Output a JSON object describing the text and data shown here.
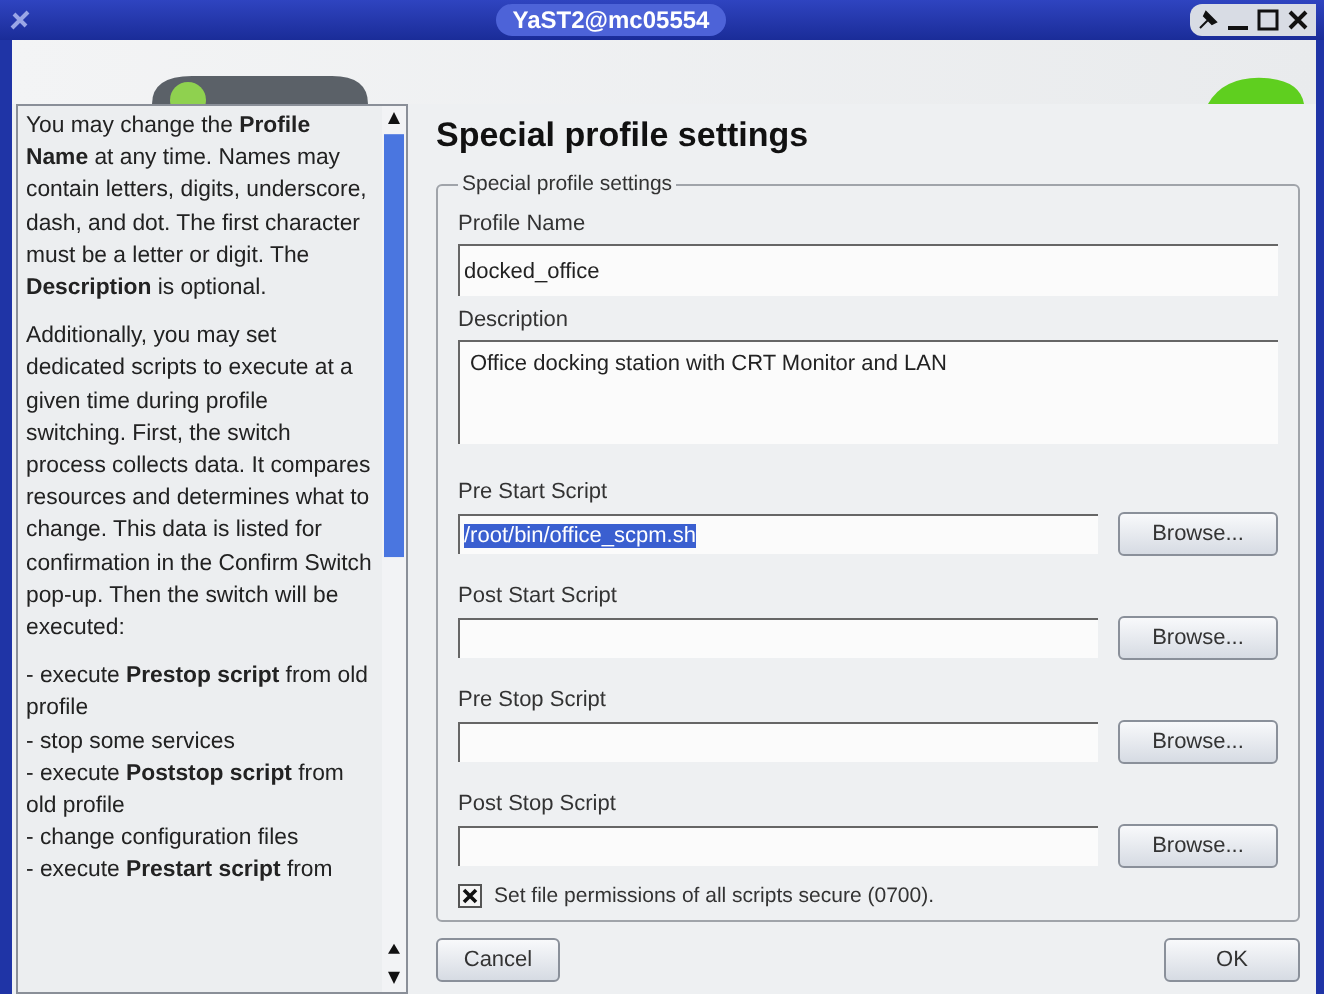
{
  "window": {
    "title": "YaST2@mc05554"
  },
  "help": {
    "paragraphs": [
      "You may change the **Profile Name** at any time. Names may contain letters, digits, underscore, dash, and dot. The first character must be a letter or digit. The **Description** is optional.",
      "Additionally, you may set dedicated scripts to execute at a given time during profile switching. First, the switch process collects data. It compares resources and determines what to change. This data is listed for confirmation in the Confirm Switch pop-up. Then the switch will be executed:"
    ],
    "steps": [
      "- execute **Prestop script** from old profile",
      "- stop some services",
      "- execute **Poststop script** from old profile",
      "- change configuration files",
      "- execute **Prestart script** from"
    ]
  },
  "heading": "Special profile settings",
  "group": {
    "title": "Special profile settings",
    "profile_name": {
      "label": "Profile Name",
      "value": "docked_office"
    },
    "description": {
      "label": "Description",
      "value": "Office docking station with CRT Monitor and LAN"
    },
    "scripts": [
      {
        "label": "Pre Start Script",
        "value": "/root/bin/office_scpm.sh",
        "highlighted": true,
        "button": "Browse..."
      },
      {
        "label": "Post Start Script",
        "button": "Browse..."
      },
      {
        "label": "Pre Stop Script",
        "button": "Browse..."
      },
      {
        "label": "Post Stop Script",
        "button": "Browse..."
      }
    ],
    "secure": {
      "label": "Set file permissions of all scripts secure (0700).",
      "checked": true
    }
  },
  "buttons": {
    "cancel": "Cancel",
    "ok": "OK"
  }
}
